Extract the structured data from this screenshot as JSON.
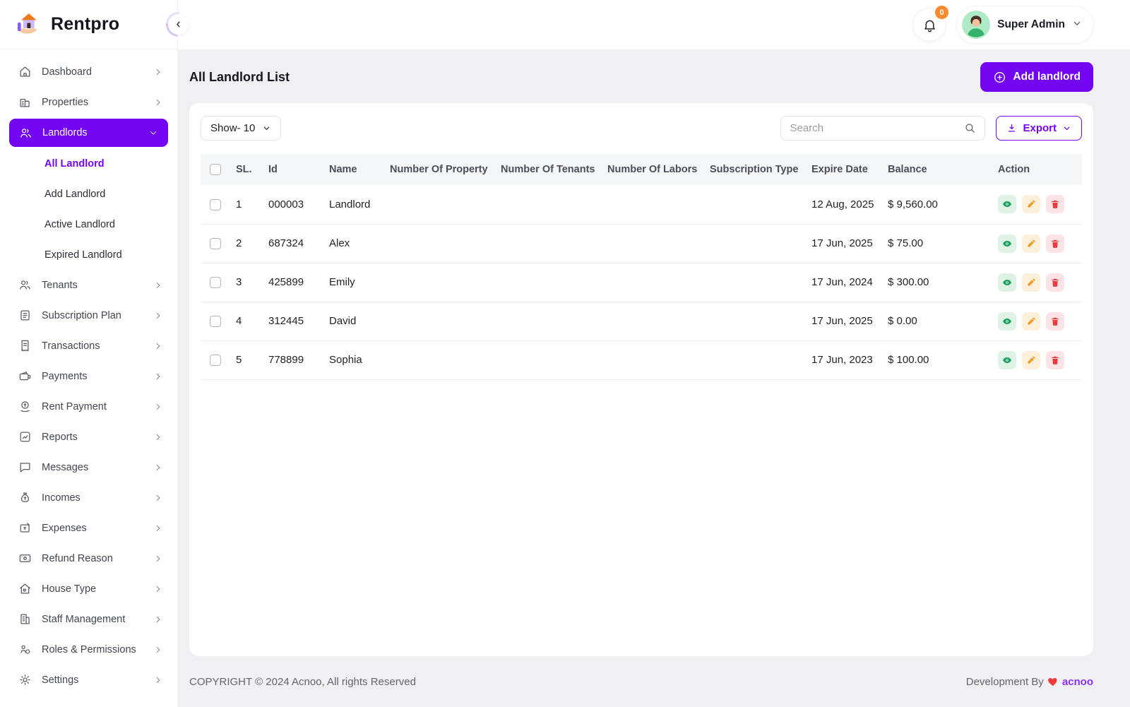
{
  "colors": {
    "primary": "#7405f2",
    "badge_orange": "#fb8a2c",
    "view_green": "#18a05c",
    "edit_orange": "#f5991f",
    "delete_red": "#e93c3c",
    "heart_red": "#f2383a"
  },
  "brand": {
    "name": "Rentpro",
    "logo_icon": "house-hand-icon"
  },
  "topbar": {
    "collapse_icon": "chevron-left-icon",
    "bell_icon": "bell-icon",
    "notification_count": "0",
    "user_name": "Super Admin",
    "avatar_icon": "user-avatar"
  },
  "sidebar": {
    "items": [
      {
        "label": "Dashboard",
        "icon": "home-icon"
      },
      {
        "label": "Properties",
        "icon": "buildings-icon"
      },
      {
        "label": "Landlords",
        "icon": "landlords-icon",
        "active": true,
        "expanded": true,
        "children": [
          {
            "label": "All Landlord",
            "active": true
          },
          {
            "label": "Add Landlord"
          },
          {
            "label": "Active Landlord"
          },
          {
            "label": "Expired Landlord"
          }
        ]
      },
      {
        "label": "Tenants",
        "icon": "tenants-icon"
      },
      {
        "label": "Subscription Plan",
        "icon": "subscription-icon"
      },
      {
        "label": "Transactions",
        "icon": "transactions-icon"
      },
      {
        "label": "Payments",
        "icon": "payments-icon"
      },
      {
        "label": "Rent Payment",
        "icon": "rent-payment-icon"
      },
      {
        "label": "Reports",
        "icon": "reports-icon"
      },
      {
        "label": "Messages",
        "icon": "messages-icon"
      },
      {
        "label": "Incomes",
        "icon": "incomes-icon"
      },
      {
        "label": "Expenses",
        "icon": "expenses-icon"
      },
      {
        "label": "Refund Reason",
        "icon": "refund-icon"
      },
      {
        "label": "House Type",
        "icon": "house-type-icon"
      },
      {
        "label": "Staff Management",
        "icon": "staff-icon"
      },
      {
        "label": "Roles & Permissions",
        "icon": "roles-icon"
      },
      {
        "label": "Settings",
        "icon": "settings-icon"
      }
    ]
  },
  "page": {
    "title": "All Landlord List",
    "add_button": "Add landlord"
  },
  "toolbar": {
    "show_label": "Show- 10",
    "search_placeholder": "Search",
    "export_label": "Export"
  },
  "table": {
    "headers": [
      "SL.",
      "Id",
      "Name",
      "Number Of Property",
      "Number Of Tenants",
      "Number Of Labors",
      "Subscription Type",
      "Expire Date",
      "Balance",
      "Action"
    ],
    "rows": [
      {
        "sl": "1",
        "id": "000003",
        "name": "Landlord",
        "property": "",
        "tenants": "",
        "labors": "",
        "subscription": "",
        "expire": "12 Aug, 2025",
        "balance": "$ 9,560.00"
      },
      {
        "sl": "2",
        "id": "687324",
        "name": "Alex",
        "property": "",
        "tenants": "",
        "labors": "",
        "subscription": "",
        "expire": "17 Jun, 2025",
        "balance": "$ 75.00"
      },
      {
        "sl": "3",
        "id": "425899",
        "name": "Emily",
        "property": "",
        "tenants": "",
        "labors": "",
        "subscription": "",
        "expire": "17 Jun, 2024",
        "balance": "$ 300.00"
      },
      {
        "sl": "4",
        "id": "312445",
        "name": "David",
        "property": "",
        "tenants": "",
        "labors": "",
        "subscription": "",
        "expire": "17 Jun, 2025",
        "balance": "$ 0.00"
      },
      {
        "sl": "5",
        "id": "778899",
        "name": "Sophia",
        "property": "",
        "tenants": "",
        "labors": "",
        "subscription": "",
        "expire": "17 Jun, 2023",
        "balance": "$ 100.00"
      }
    ],
    "row_action_icons": [
      "eye-icon",
      "pencil-icon",
      "trash-icon"
    ]
  },
  "footer": {
    "copyright": "COPYRIGHT © 2024 Acnoo, All rights Reserved",
    "dev_by": "Development By",
    "heart_icon": "heart-icon",
    "dev_brand": "acnoo"
  }
}
